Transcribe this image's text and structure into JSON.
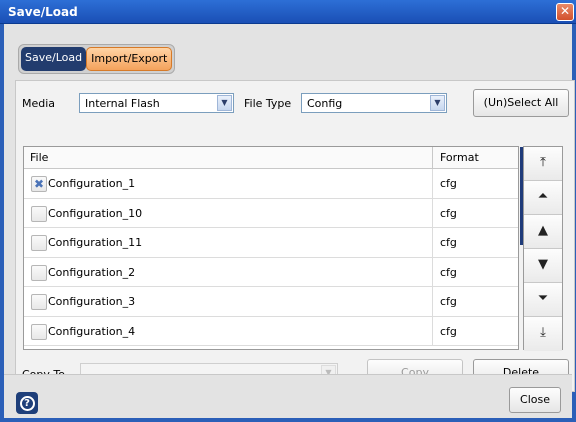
{
  "window": {
    "title": "Save/Load",
    "close_glyph": "✕"
  },
  "tabs": [
    {
      "label": "Save/Load",
      "active": true
    },
    {
      "label": "Import/Export",
      "active": false
    }
  ],
  "media": {
    "label": "Media",
    "value": "Internal Flash"
  },
  "file_type": {
    "label": "File Type",
    "value": "Config"
  },
  "select_all_label": "(Un)Select All",
  "table": {
    "headers": {
      "file": "File",
      "format": "Format"
    },
    "rows": [
      {
        "name": "Configuration_1",
        "format": "cfg",
        "checked": true
      },
      {
        "name": "Configuration_10",
        "format": "cfg",
        "checked": false
      },
      {
        "name": "Configuration_11",
        "format": "cfg",
        "checked": false
      },
      {
        "name": "Configuration_2",
        "format": "cfg",
        "checked": false
      },
      {
        "name": "Configuration_3",
        "format": "cfg",
        "checked": false
      },
      {
        "name": "Configuration_4",
        "format": "cfg",
        "checked": false
      }
    ]
  },
  "nav_buttons": [
    {
      "name": "scroll-top-icon",
      "glyph": "⤒"
    },
    {
      "name": "page-up-icon",
      "glyph": "⏶"
    },
    {
      "name": "line-up-icon",
      "glyph": "▲"
    },
    {
      "name": "line-down-icon",
      "glyph": "▼"
    },
    {
      "name": "page-down-icon",
      "glyph": "⏷"
    },
    {
      "name": "scroll-bottom-icon",
      "glyph": "⤓"
    }
  ],
  "copy_to": {
    "label": "Copy To",
    "value": ""
  },
  "copy_label": "Copy",
  "delete_label": "Delete",
  "close_label": "Close",
  "help_glyph": "?",
  "colors": {
    "title_blue": "#2d6fd6",
    "tab_active": "#223c6e",
    "tab_inactive": "#f4a25c"
  }
}
